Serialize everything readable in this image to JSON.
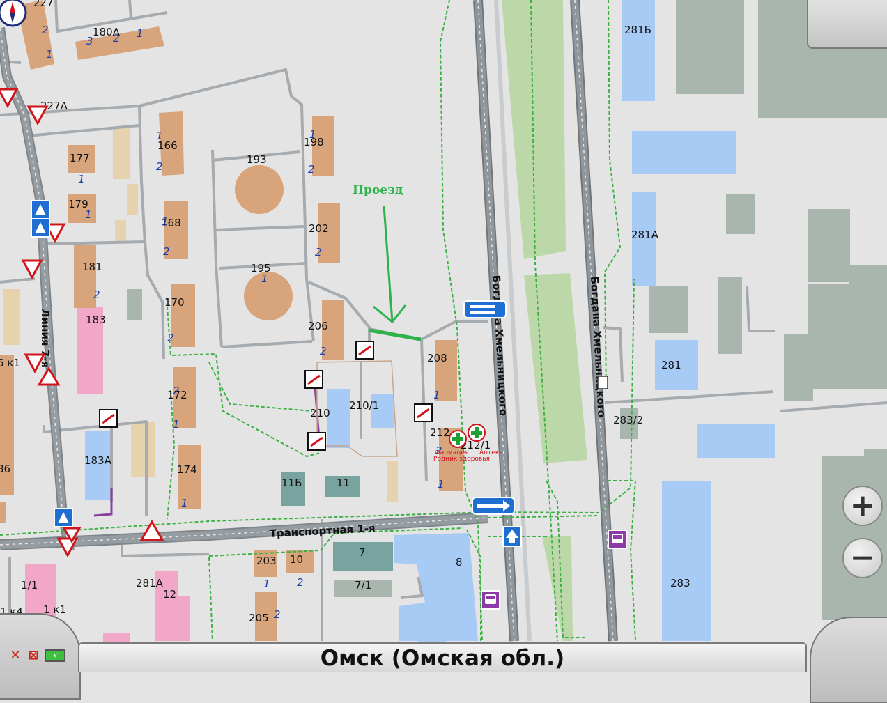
{
  "map": {
    "city_label": "Омск (Омская обл.)",
    "annotation": {
      "text": "Проезд",
      "color": "#2db34a"
    },
    "streets": [
      {
        "name": "Линия 7-я"
      },
      {
        "name": "Транспортная 1-я"
      },
      {
        "name": "Богдана Хмельницкого"
      },
      {
        "name": "Богдана Хмельницкого"
      }
    ],
    "house_numbers": [
      "227",
      "180А",
      "227А",
      "177",
      "179",
      "166",
      "168",
      "170",
      "172",
      "174",
      "181",
      "183",
      "183А",
      "193",
      "195",
      "198",
      "202",
      "206",
      "208",
      "210",
      "210/1",
      "212",
      "212/1",
      "11Б",
      "11",
      "7",
      "7/1",
      "8",
      "203",
      "10",
      "205",
      "281А",
      "12",
      "1/1",
      "1 к1",
      "1 к4",
      "6 к1",
      "86",
      "281Б",
      "281А",
      "281",
      "283/2",
      "283"
    ],
    "entrance_numbers": [
      "1",
      "2",
      "3"
    ],
    "poi": {
      "name": "Фармация",
      "sub": "Родник здоровья",
      "name2": "Аптека"
    }
  },
  "controls": {
    "zoom_in": "+",
    "zoom_out": "−"
  },
  "colors": {
    "background": "#e4e4e4",
    "residential": "#d7a47c",
    "road_major": "#8c9399",
    "road_minor": "#a6abaf",
    "green_strip": "#bcd8a9",
    "footpath": "#3cb043",
    "water_blue": "#a7cbf4",
    "industrial_gray": "#a9b6ad",
    "pink": "#f2a6c8",
    "pale": "#e6d3ae"
  },
  "icons": [
    "compass-icon",
    "yield-sign-icon",
    "pedestrian-crossing-icon",
    "barrier-icon",
    "pharmacy-icon",
    "bus-stop-icon",
    "one-way-arrow-icon",
    "children-sign-icon",
    "gps-off-icon",
    "sound-off-icon",
    "battery-icon"
  ]
}
